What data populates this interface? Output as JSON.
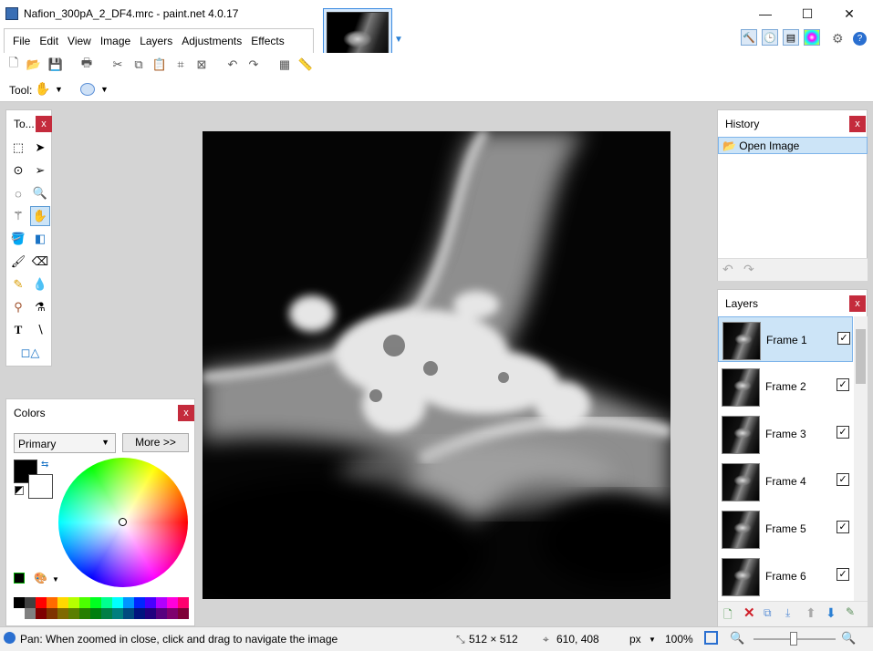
{
  "window": {
    "title": "Nafion_300pA_2_DF4.mrc - paint.net 4.0.17",
    "min_glyph": "—",
    "max_glyph": "☐",
    "close_glyph": "✕"
  },
  "menu": [
    "File",
    "Edit",
    "View",
    "Image",
    "Layers",
    "Adjustments",
    "Effects"
  ],
  "toolbar_row": {
    "tool_label": "Tool:"
  },
  "tools_panel": {
    "title": "To...",
    "close": "x"
  },
  "colors_panel": {
    "title": "Colors",
    "close": "x",
    "mode": "Primary",
    "more_button": "More >>",
    "primary_color": "#000000",
    "secondary_color": "#ffffff",
    "palette": [
      "#000000",
      "#404040",
      "#ff0000",
      "#ff6a00",
      "#ffd800",
      "#b6ff00",
      "#4cff00",
      "#00ff21",
      "#00ff90",
      "#00ffff",
      "#0094ff",
      "#0026ff",
      "#4800ff",
      "#b200ff",
      "#ff00dc",
      "#ff006e",
      "#ffffff",
      "#808080",
      "#7f0000",
      "#7f3300",
      "#7f6a00",
      "#5b7f00",
      "#267f00",
      "#007f0e",
      "#007f46",
      "#007f7f",
      "#004a7f",
      "#00137f",
      "#21007f",
      "#57007f",
      "#7f006e",
      "#7f0037"
    ]
  },
  "history_panel": {
    "title": "History",
    "close": "x",
    "items": [
      "Open Image"
    ]
  },
  "layers_panel": {
    "title": "Layers",
    "close": "x",
    "layers": [
      {
        "name": "Frame 1",
        "visible": "✓"
      },
      {
        "name": "Frame 2",
        "visible": "✓"
      },
      {
        "name": "Frame 3",
        "visible": "✓"
      },
      {
        "name": "Frame 4",
        "visible": "✓"
      },
      {
        "name": "Frame 5",
        "visible": "✓"
      },
      {
        "name": "Frame 6",
        "visible": "✓"
      }
    ]
  },
  "status": {
    "hint": "Pan: When zoomed in close, click and drag to navigate the image",
    "image_size": "512 × 512",
    "cursor": "610, 408",
    "units": "px",
    "zoom": "100%"
  }
}
